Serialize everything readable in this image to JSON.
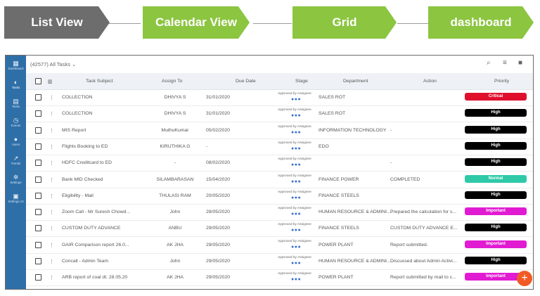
{
  "steps": [
    {
      "label": "List View",
      "style": "gray"
    },
    {
      "label": "Calendar View",
      "style": "green"
    },
    {
      "label": "Grid",
      "style": "green"
    },
    {
      "label": "dashboard",
      "style": "green"
    }
  ],
  "sidebar": {
    "items": [
      {
        "label": "Dashboard",
        "icon": "dashboard-icon"
      },
      {
        "label": "Tasks",
        "icon": "tasks-icon"
      },
      {
        "label": "Tasks",
        "icon": "tasks-list-icon"
      },
      {
        "label": "Events",
        "icon": "events-icon"
      },
      {
        "label": "Users",
        "icon": "users-icon"
      },
      {
        "label": "Trends",
        "icon": "trends-icon"
      },
      {
        "label": "Settings",
        "icon": "settings-icon"
      },
      {
        "label": "Settings v3",
        "icon": "settings-v3-icon"
      }
    ]
  },
  "toolbar": {
    "filter_label": "(42577) All Tasks",
    "icons": [
      "search-icon",
      "filter-icon",
      "grid-icon"
    ]
  },
  "table": {
    "columns": [
      "Task Subject",
      "Assign To",
      "Due Date",
      "Stage",
      "Department",
      "Action",
      "Priority"
    ],
    "stage_prefix": "Approved by Assignee",
    "dots": "●●●",
    "rows": [
      {
        "subject": "COLLECTION",
        "assign": "DHIVYA S",
        "due": "31/01/2020",
        "dept": "SALES ROT",
        "action": "",
        "priority": "Critical",
        "pcolor": "#e0102c"
      },
      {
        "subject": "COLLECTION",
        "assign": "DHIVYA S",
        "due": "31/01/2020",
        "dept": "SALES ROT",
        "action": "",
        "priority": "High",
        "pcolor": "#000000"
      },
      {
        "subject": "MIS Report",
        "assign": "MuthuKumar",
        "due": "05/02/2020",
        "dept": "INFORMATION TECHNOLOGY",
        "action": "-",
        "priority": "High",
        "pcolor": "#000000"
      },
      {
        "subject": "Flights Booking to ED",
        "assign": "KIRUTHIKA G",
        "due": "-",
        "dept": "EDO",
        "action": "",
        "priority": "High",
        "pcolor": "#000000"
      },
      {
        "subject": "HDFC Creditcard to ED",
        "assign": "-",
        "due": "08/02/2020",
        "dept": "",
        "action": "-",
        "priority": "High",
        "pcolor": "#000000"
      },
      {
        "subject": "Bank MID Checked",
        "assign": "SILAMBARASAN",
        "due": "15/04/2020",
        "dept": "FINANCE POWER",
        "action": "COMPLETED",
        "priority": "Normal",
        "pcolor": "#2fc9a8"
      },
      {
        "subject": "Eligibility - Mail",
        "assign": "THULASI RAM",
        "due": "20/05/2020",
        "dept": "FINANCE STEELS",
        "action": "",
        "priority": "High",
        "pcolor": "#000000"
      },
      {
        "subject": "Zoom Call - Mr Suresh Chowd...",
        "assign": "John",
        "due": "28/05/2020",
        "dept": "HUMAN RESOURCE & ADMINI...",
        "action": "Prepared the calculation for s...",
        "priority": "Important",
        "pcolor": "#e11bd2"
      },
      {
        "subject": "CUSTOM DUTY ADVANCE",
        "assign": "ANBU",
        "due": "29/05/2020",
        "dept": "FINANCE STEELS",
        "action": "CUSTOM DUTY ADVANCE E...",
        "priority": "High",
        "pcolor": "#000000"
      },
      {
        "subject": "GAIR Comparison report 26.0...",
        "assign": "AK JHA",
        "due": "29/05/2020",
        "dept": "POWER PLANT",
        "action": "Report submitted.",
        "priority": "Important",
        "pcolor": "#e11bd2"
      },
      {
        "subject": "Concall - Admin Team",
        "assign": "John",
        "due": "29/05/2020",
        "dept": "HUMAN RESOURCE & ADMINI...",
        "action": "Discussed about Admin Activi...",
        "priority": "High",
        "pcolor": "#000000"
      },
      {
        "subject": "ARB report of coal dt. 28.05.20",
        "assign": "AK JHA",
        "due": "29/05/2020",
        "dept": "POWER PLANT",
        "action": "Report submitted by mail to c...",
        "priority": "Important",
        "pcolor": "#e11bd2"
      }
    ]
  },
  "fab_label": "+"
}
